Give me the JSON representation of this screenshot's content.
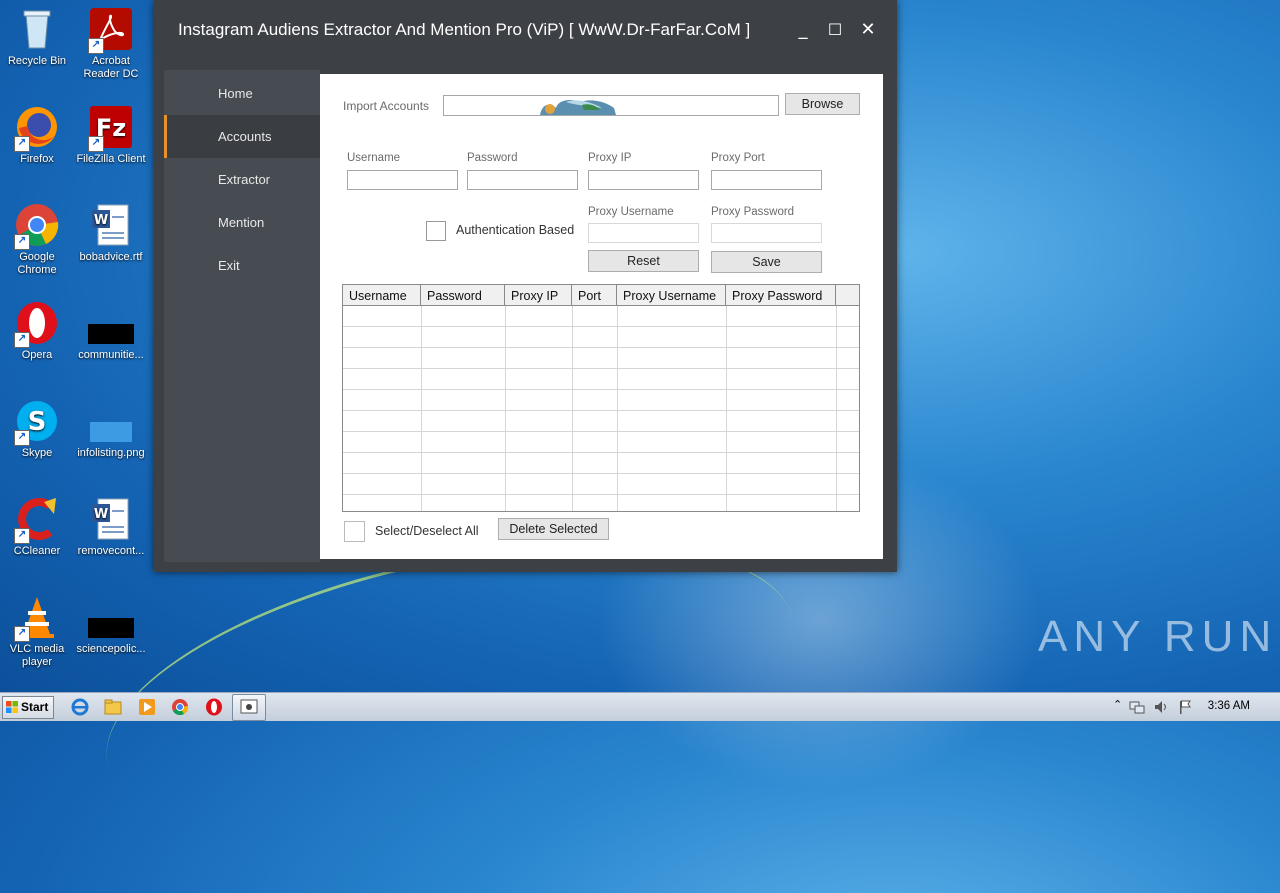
{
  "desktop": {
    "icons": [
      {
        "label": "Recycle Bin"
      },
      {
        "label": "Acrobat Reader DC"
      },
      {
        "label": "Firefox"
      },
      {
        "label": "FileZilla Client"
      },
      {
        "label": "Google Chrome"
      },
      {
        "label": "bobadvice.rtf"
      },
      {
        "label": "Opera"
      },
      {
        "label": "communitie..."
      },
      {
        "label": "Skype"
      },
      {
        "label": "infolisting.png"
      },
      {
        "label": "CCleaner"
      },
      {
        "label": "removecont..."
      },
      {
        "label": "VLC media player"
      },
      {
        "label": "sciencepolic..."
      }
    ]
  },
  "window": {
    "title": "Instagram Audiens Extractor And Mention Pro (ViP) [ WwW.Dr-FarFar.CoM ]",
    "controls": {
      "minimize": "_",
      "maximize": "☐",
      "close": "✕"
    }
  },
  "sidebar": {
    "items": [
      {
        "label": "Home"
      },
      {
        "label": "Accounts"
      },
      {
        "label": "Extractor"
      },
      {
        "label": "Mention"
      },
      {
        "label": "Exit"
      }
    ],
    "active": "Accounts"
  },
  "accounts": {
    "import_label": "Import Accounts",
    "import_value": "",
    "browse_label": "Browse",
    "username_label": "Username",
    "password_label": "Password",
    "proxy_ip_label": "Proxy IP",
    "proxy_port_label": "Proxy Port",
    "auth_label": "Authentication Based",
    "proxy_username_label": "Proxy Username",
    "proxy_password_label": "Proxy Password",
    "reset_label": "Reset",
    "save_label": "Save",
    "columns": [
      "Username",
      "Password",
      "Proxy IP",
      "Port",
      "Proxy Username",
      "Proxy Password"
    ],
    "select_all_label": "Select/Deselect All",
    "delete_label": "Delete Selected"
  },
  "taskbar": {
    "start_label": "Start",
    "clock": "3:36 AM"
  },
  "watermark": "ANY RUN",
  "colors": {
    "accent": "#e8912c",
    "window_bg": "#3d4045",
    "sidebar_bg": "#474b52"
  }
}
